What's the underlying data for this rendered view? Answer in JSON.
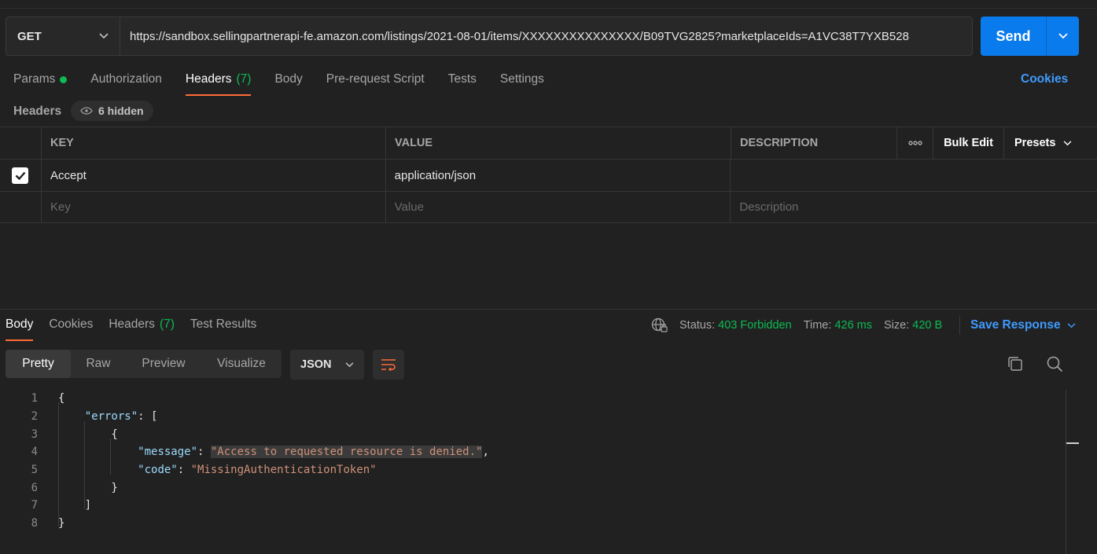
{
  "request": {
    "method": "GET",
    "url": "https://sandbox.sellingpartnerapi-fe.amazon.com/listings/2021-08-01/items/XXXXXXXXXXXXXXX/B09TVG2825?marketplaceIds=A1VC38T7YXB528",
    "send_label": "Send"
  },
  "request_tabs": [
    {
      "label": "Params"
    },
    {
      "label": "Authorization"
    },
    {
      "label": "Headers",
      "count": "(7)"
    },
    {
      "label": "Body"
    },
    {
      "label": "Pre-request Script"
    },
    {
      "label": "Tests"
    },
    {
      "label": "Settings"
    }
  ],
  "cookies_link": "Cookies",
  "headers_section": {
    "label": "Headers",
    "hidden_count": "6 hidden"
  },
  "headers_table": {
    "columns": [
      "KEY",
      "VALUE",
      "DESCRIPTION"
    ],
    "bulk_edit": "Bulk Edit",
    "presets": "Presets",
    "rows": [
      {
        "key": "Accept",
        "value": "application/json",
        "description": ""
      }
    ],
    "placeholder": {
      "key": "Key",
      "value": "Value",
      "description": "Description"
    }
  },
  "response_tabs": [
    {
      "label": "Body"
    },
    {
      "label": "Cookies"
    },
    {
      "label": "Headers",
      "count": "(7)"
    },
    {
      "label": "Test Results"
    }
  ],
  "response_stats": {
    "status_label": "Status:",
    "status_value": "403 Forbidden",
    "time_label": "Time:",
    "time_value": "426 ms",
    "size_label": "Size:",
    "size_value": "420 B",
    "save_response": "Save Response"
  },
  "view_modes": [
    "Pretty",
    "Raw",
    "Preview",
    "Visualize"
  ],
  "format": "JSON",
  "code_lines": [
    {
      "n": "1"
    },
    {
      "n": "2",
      "key": "\"errors\""
    },
    {
      "n": "3"
    },
    {
      "n": "4",
      "key": "\"message\"",
      "value": "\"Access to requested resource is denied.\""
    },
    {
      "n": "5",
      "key": "\"code\"",
      "value": "\"MissingAuthenticationToken\""
    },
    {
      "n": "6"
    },
    {
      "n": "7"
    },
    {
      "n": "8"
    }
  ],
  "colors": {
    "accent_orange": "#ff6c37",
    "send_blue": "#097bed",
    "status_green": "#0cbb52",
    "link_blue": "#3f9bff"
  }
}
